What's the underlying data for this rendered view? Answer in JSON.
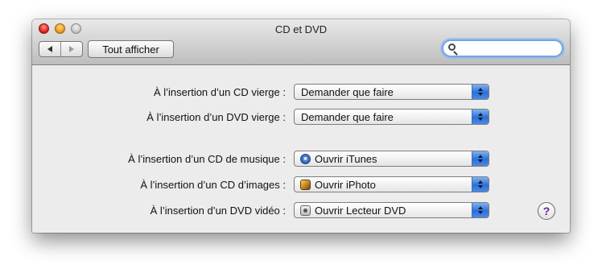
{
  "window": {
    "title": "CD et DVD"
  },
  "toolbar": {
    "back_icon": "back-arrow-icon",
    "forward_icon": "forward-arrow-icon",
    "show_all_label": "Tout afficher",
    "search": {
      "value": "",
      "placeholder": ""
    }
  },
  "rows": [
    {
      "label": "À l’insertion d’un CD vierge :",
      "value": "Demander que faire",
      "icon": null
    },
    {
      "label": "À l’insertion d’un DVD vierge :",
      "value": "Demander que faire",
      "icon": null
    },
    {
      "label": "À l’insertion d’un CD de musique :",
      "value": "Ouvrir iTunes",
      "icon": "itunes-icon"
    },
    {
      "label": "À l’insertion d’un CD d’images :",
      "value": "Ouvrir iPhoto",
      "icon": "iphoto-icon"
    },
    {
      "label": "À l’insertion d’un DVD vidéo :",
      "value": "Ouvrir Lecteur DVD",
      "icon": "dvd-player-icon"
    }
  ],
  "help": {
    "label": "?"
  },
  "colors": {
    "accent": "#2d6fd8",
    "help_glyph": "#5a2a9a"
  }
}
